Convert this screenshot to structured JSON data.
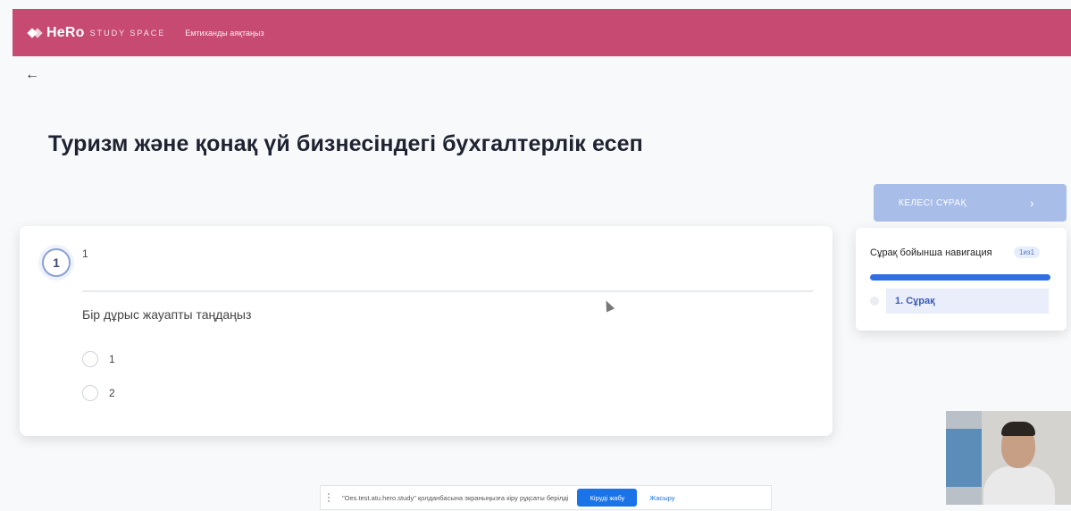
{
  "header": {
    "brand": "HeRo",
    "brand_sub": "STUDY SPACE",
    "nav_link": "Емтиханды аяқтаңыз"
  },
  "back_icon": "arrow-left-icon",
  "page": {
    "title": "Туризм және қонақ үй бизнесіндегі бухгалтерлік есеп"
  },
  "question": {
    "number": "1",
    "text": "1",
    "prompt": "Бір дұрыс жауапты таңдаңыз",
    "options": [
      {
        "label": "1"
      },
      {
        "label": "2"
      }
    ]
  },
  "sidebar": {
    "next_label": "КЕЛЕСІ СҰРАҚ",
    "next_icon": "chevron-right-icon",
    "nav_title": "Сұрақ бойынша навигация",
    "nav_badge": "1из1",
    "progress_fraction": 1.0,
    "items": [
      {
        "label": "1. Сұрақ"
      }
    ]
  },
  "share_bar": {
    "message": "\"Oes.test.atu.hero.study\" қолданбасына экраныңызға кіру рұқсаты берілді",
    "stop_label": "Кіруді жабу",
    "hide_label": "Жасыру"
  },
  "colors": {
    "header_bg": "#c74a73",
    "accent_blue": "#2f6fe0",
    "next_btn_bg": "#a9bde9"
  }
}
